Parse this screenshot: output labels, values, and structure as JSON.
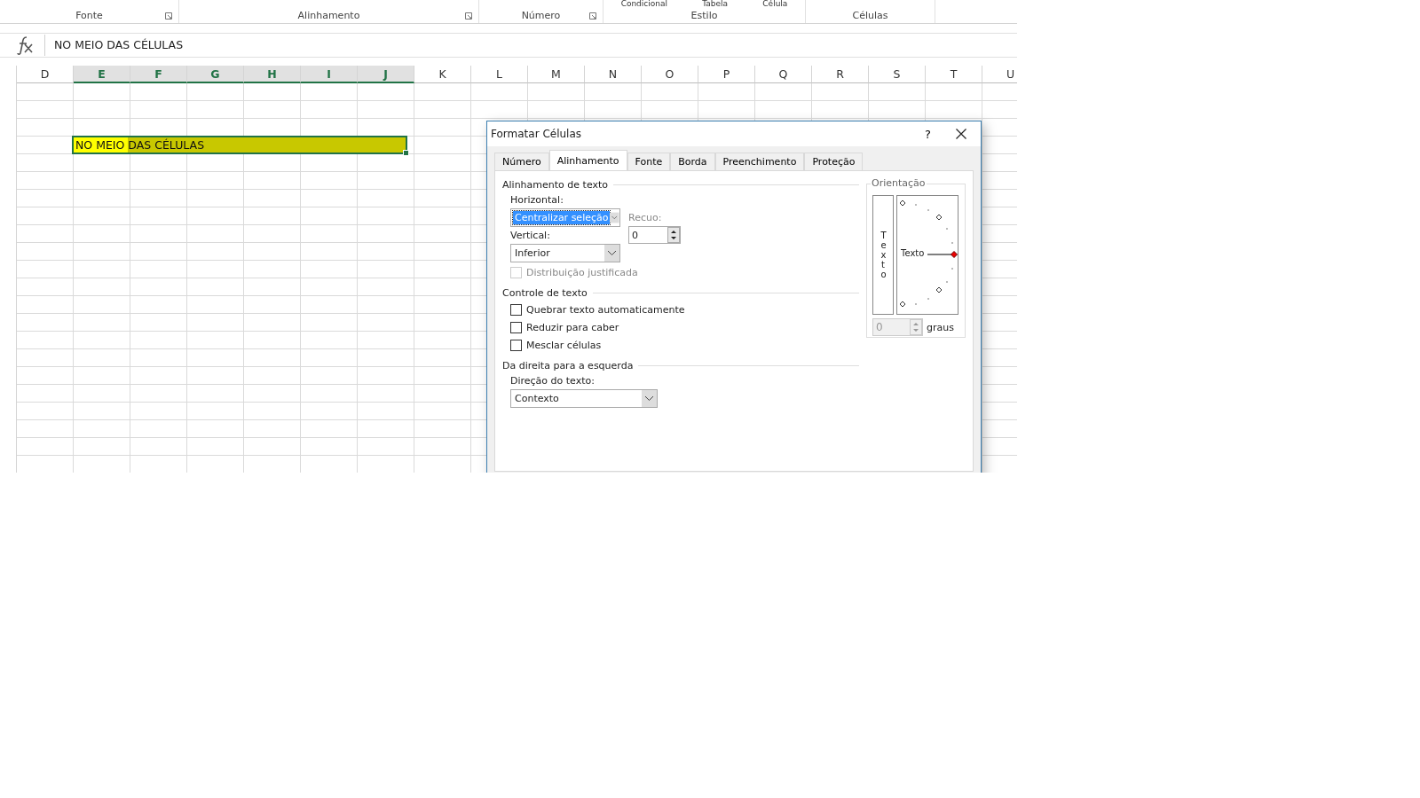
{
  "ribbon": {
    "groups": [
      {
        "label": "Fonte",
        "launcher": true
      },
      {
        "label": "Alinhamento",
        "launcher": true
      },
      {
        "label": "Número",
        "launcher": true
      },
      {
        "label": "Estilo",
        "launcher": false,
        "cut_labels": [
          "Condicional",
          "Tabela",
          "Célula"
        ]
      },
      {
        "label": "Células",
        "launcher": false
      }
    ]
  },
  "formula_bar": {
    "value": "NO MEIO DAS CÉLULAS"
  },
  "columns": [
    {
      "label": "D",
      "selected": false
    },
    {
      "label": "E",
      "selected": true
    },
    {
      "label": "F",
      "selected": true
    },
    {
      "label": "G",
      "selected": true
    },
    {
      "label": "H",
      "selected": true
    },
    {
      "label": "I",
      "selected": true
    },
    {
      "label": "J",
      "selected": true
    },
    {
      "label": "K",
      "selected": false
    },
    {
      "label": "L",
      "selected": false
    },
    {
      "label": "M",
      "selected": false
    },
    {
      "label": "N",
      "selected": false
    },
    {
      "label": "O",
      "selected": false
    },
    {
      "label": "P",
      "selected": false
    },
    {
      "label": "Q",
      "selected": false
    },
    {
      "label": "R",
      "selected": false
    },
    {
      "label": "S",
      "selected": false
    },
    {
      "label": "T",
      "selected": false
    },
    {
      "label": "U",
      "selected": false
    }
  ],
  "active_cell": {
    "text": "NO MEIO DAS CÉLULAS"
  },
  "dialog": {
    "title": "Formatar Células",
    "help": "?",
    "tabs": [
      {
        "label": "Número",
        "selected": false
      },
      {
        "label": "Alinhamento",
        "selected": true
      },
      {
        "label": "Fonte",
        "selected": false
      },
      {
        "label": "Borda",
        "selected": false
      },
      {
        "label": "Preenchimento",
        "selected": false
      },
      {
        "label": "Proteção",
        "selected": false
      }
    ],
    "text_alignment": {
      "heading": "Alinhamento de texto",
      "horizontal_label": "Horizontal:",
      "horizontal_value": "Centralizar seleção",
      "indent_label": "Recuo:",
      "indent_value": "0",
      "vertical_label": "Vertical:",
      "vertical_value": "Inferior",
      "justify_distributed": {
        "label": "Distribuição justificada",
        "checked": false,
        "disabled": true
      }
    },
    "text_control": {
      "heading": "Controle de texto",
      "options": [
        {
          "label": "Quebrar texto automaticamente",
          "checked": false
        },
        {
          "label": "Reduzir para caber",
          "checked": false
        },
        {
          "label": "Mesclar células",
          "checked": false
        }
      ]
    },
    "right_to_left": {
      "heading": "Da direita para a esquerda",
      "direction_label": "Direção do texto:",
      "direction_value": "Contexto"
    },
    "orientation": {
      "legend": "Orientação",
      "vertical_text": "Texto",
      "dial_text": "Texto",
      "degrees_value": "0",
      "degrees_label": "graus"
    }
  }
}
